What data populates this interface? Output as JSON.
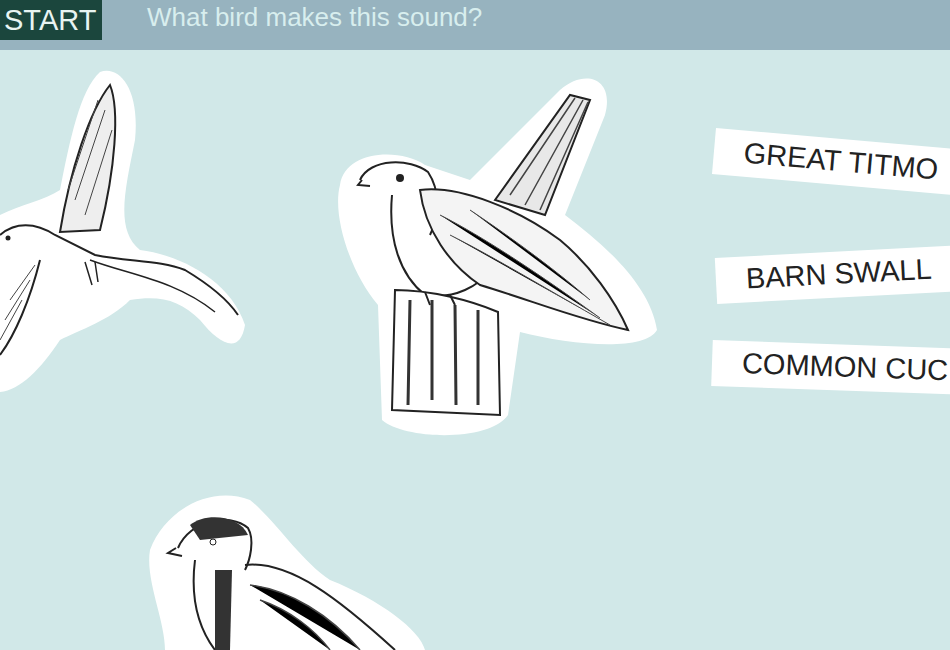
{
  "header": {
    "start": "START",
    "prompt": "What bird makes this sound?"
  },
  "answers": [
    {
      "label": "GREAT TITMO"
    },
    {
      "label": "BARN SWALL"
    },
    {
      "label": "COMMON CUC"
    }
  ]
}
